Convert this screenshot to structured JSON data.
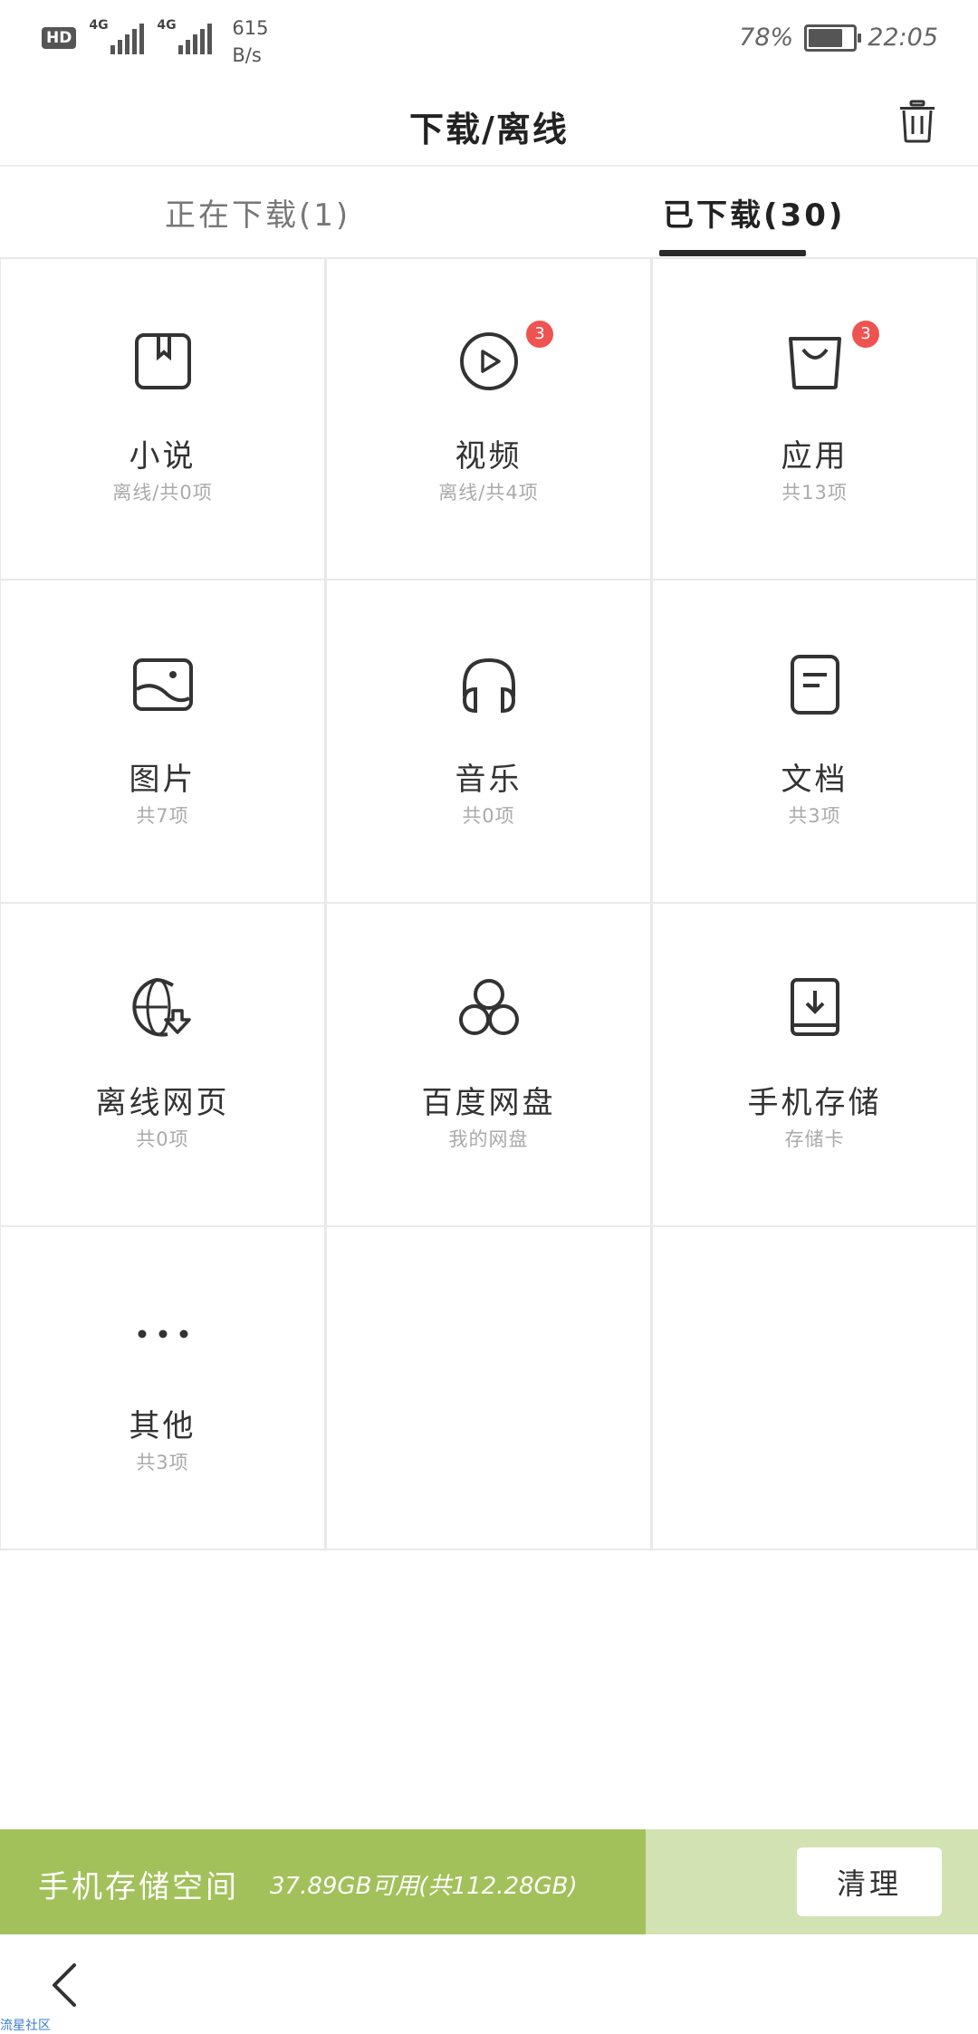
{
  "status_bar": {
    "hd": "HD",
    "network1": "4G",
    "network2": "4G",
    "speed_value": "615",
    "speed_unit": "B/s",
    "battery": "78%",
    "time": "22:05"
  },
  "header": {
    "title": "下载/离线"
  },
  "tabs": [
    {
      "label": "正在下载(1)",
      "active": false
    },
    {
      "label": "已下载(30)",
      "active": true
    }
  ],
  "categories": [
    {
      "name": "小说",
      "sub": "离线/共0项",
      "icon": "book-icon",
      "badge": ""
    },
    {
      "name": "视频",
      "sub": "离线/共4项",
      "icon": "play-icon",
      "badge": "3"
    },
    {
      "name": "应用",
      "sub": "共13项",
      "icon": "bag-icon",
      "badge": "3"
    },
    {
      "name": "图片",
      "sub": "共7项",
      "icon": "image-icon",
      "badge": ""
    },
    {
      "name": "音乐",
      "sub": "共0项",
      "icon": "headphones-icon",
      "badge": ""
    },
    {
      "name": "文档",
      "sub": "共3项",
      "icon": "document-icon",
      "badge": ""
    },
    {
      "name": "离线网页",
      "sub": "共0项",
      "icon": "globe-download-icon",
      "badge": ""
    },
    {
      "name": "百度网盘",
      "sub": "我的网盘",
      "icon": "cloud-circles-icon",
      "badge": ""
    },
    {
      "name": "手机存储",
      "sub": "存储卡",
      "icon": "storage-download-icon",
      "badge": ""
    },
    {
      "name": "其他",
      "sub": "共3项",
      "icon": "more-dots-icon",
      "badge": ""
    }
  ],
  "storage": {
    "label": "手机存储空间",
    "info": "37.89GB可用(共112.28GB)",
    "used_fraction": 0.66,
    "clean_label": "清理"
  },
  "watermark": "流星社区",
  "colors": {
    "accent_green": "#a2c15a",
    "light_green": "#d2e2b3",
    "badge_red": "#ef5350"
  }
}
